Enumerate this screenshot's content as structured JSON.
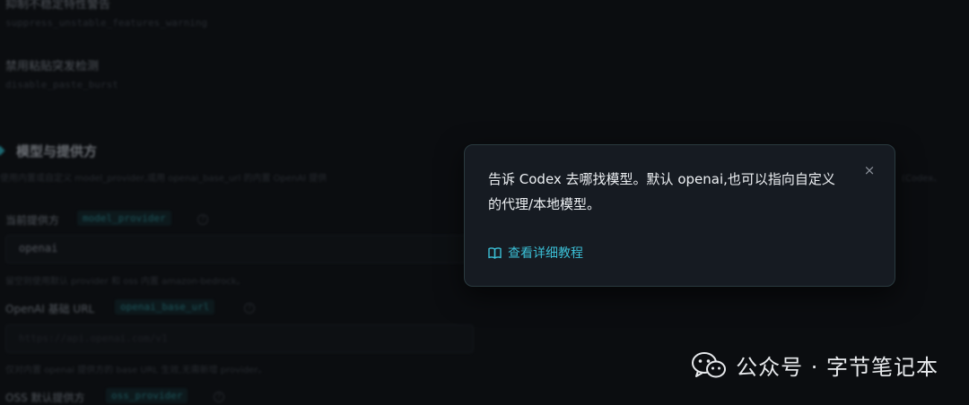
{
  "background": {
    "top_item_title": "抑制不稳定特性警告",
    "top_item_key": "suppress_unstable_features_warning",
    "item2_title": "禁用粘贴突发检测",
    "item2_key": "disable_paste_burst",
    "section_title": "模型与提供方",
    "section_desc": "使用内置或自定义 model_provider,或用 openai_base_url 的内置 OpenAI 提供",
    "section_desc_tail": "(Codex、",
    "provider_label": "当前提供方",
    "provider_tag": "model_provider",
    "provider_value": "openai",
    "provider_hint": "留空则使用默认 provider 和 oss 内置 amazon-bedrock。",
    "base_url_label": "OpenAI 基础 URL",
    "base_url_tag": "openai_base_url",
    "base_url_placeholder": "https://api.openai.com/v1",
    "base_url_hint": "仅对内置 openai 提供方的 base URL 生效,无需新增 provider。",
    "oss_label": "OSS 默认提供方",
    "oss_tag": "oss_provider"
  },
  "popover": {
    "message": "告诉 Codex 去哪找模型。默认 openai,也可以指向自定义的代理/本地模型。",
    "close_glyph": "×",
    "link_text": "查看详细教程",
    "link_icon": "book-icon",
    "accent_color": "#3bbfd6"
  },
  "watermark": {
    "text": "公众号 · 字节笔记本",
    "icon": "wechat-icon"
  }
}
